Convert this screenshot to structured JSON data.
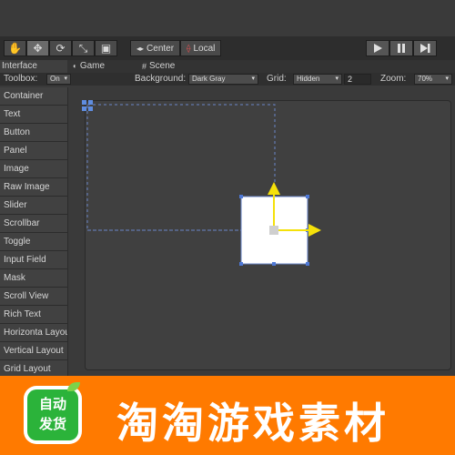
{
  "toolbar": {
    "tools": [
      "hand-icon",
      "move-icon",
      "rotate-icon",
      "scale-icon",
      "rect-icon"
    ],
    "pivot_center_label": "Center",
    "pivot_local_label": "Local",
    "playback": [
      "play-icon",
      "pause-icon",
      "step-icon"
    ]
  },
  "tabs": {
    "interface_label": "Interface",
    "game_label": "Game",
    "scene_label": "Scene"
  },
  "options": {
    "toolbox_label": "Toolbox:",
    "toolbox_value": "On",
    "background_label": "Background:",
    "background_value": "Dark Gray",
    "grid_label": "Grid:",
    "grid_value": "Hidden",
    "grid_size": "2",
    "zoom_label": "Zoom:",
    "zoom_value": "70%"
  },
  "sidebar": {
    "items": [
      {
        "label": "Container"
      },
      {
        "label": "Text"
      },
      {
        "label": "Button"
      },
      {
        "label": "Panel"
      },
      {
        "label": "Image"
      },
      {
        "label": "Raw Image"
      },
      {
        "label": "Slider"
      },
      {
        "label": "Scrollbar"
      },
      {
        "label": "Toggle"
      },
      {
        "label": "Input Field"
      },
      {
        "label": "Mask"
      },
      {
        "label": "Scroll View"
      },
      {
        "label": "Rich Text"
      },
      {
        "label": "Horizonta Layout"
      },
      {
        "label": "Vertical Layout"
      },
      {
        "label": "Grid Layout"
      }
    ]
  },
  "colors": {
    "gizmo_arrow": "#f5e10a",
    "guide_line": "#6a86c8",
    "banner": "#ff7a00",
    "badge_green": "#2bb33a"
  },
  "banner": {
    "badge_line1": "自动",
    "badge_line2": "发货",
    "title": "淘淘游戏素材"
  }
}
